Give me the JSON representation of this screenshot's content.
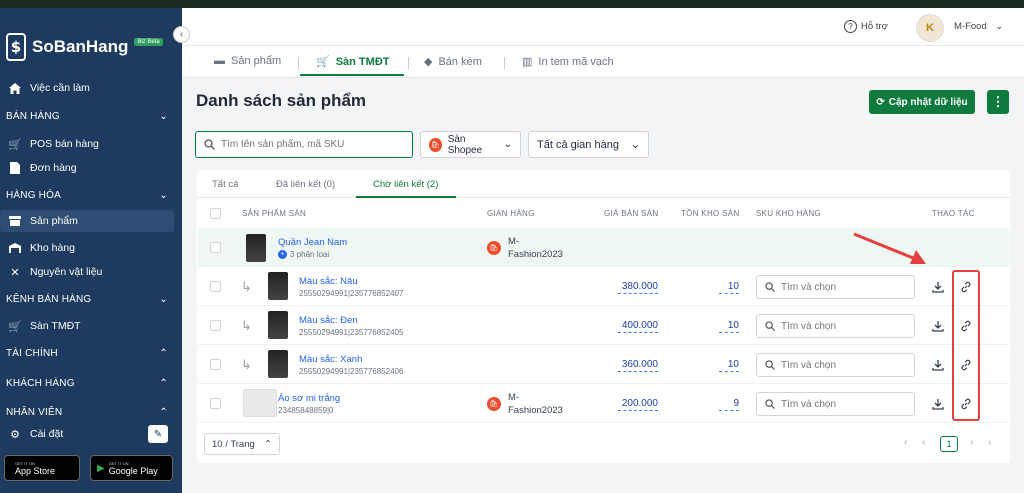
{
  "brand": {
    "name": "SoBanHang",
    "badge": "Biz Beta",
    "logo_glyph": "$"
  },
  "sidebar": {
    "todo": "Việc cần làm",
    "sales_section": "BÁN HÀNG",
    "pos": "POS bán hàng",
    "orders": "Đơn hàng",
    "goods_section": "HÀNG HÓA",
    "products": "Sản phẩm",
    "warehouse": "Kho hàng",
    "materials": "Nguyên vật liệu",
    "channels_section": "KÊNH BÁN HÀNG",
    "ecommerce": "Sàn TMĐT",
    "finance_section": "TÀI CHÍNH",
    "customers_section": "KHÁCH HÀNG",
    "staff_section": "NHÂN VIÊN",
    "settings": "Cài đặt",
    "app_store_small": "GET IT ON",
    "app_store": "App Store",
    "google_play_small": "GET IT ON",
    "google_play": "Google Play"
  },
  "header": {
    "help": "Hỗ trợ",
    "user": "M-Food",
    "avatar_initials": "K"
  },
  "top_tabs": [
    "Sản phẩm",
    "Sàn TMĐT",
    "Bán kèm",
    "In tem mã vạch"
  ],
  "page": {
    "title": "Danh sách sản phẩm",
    "update_button": "Cập nhật dữ liệu",
    "more_button": "⋮",
    "search_placeholder": "Tìm tên sản phẩm, mã SKU",
    "platform_filter": "Sàn Shopee",
    "store_filter": "Tất cả gian hàng"
  },
  "sub_tabs": [
    "Tất cả",
    "Đã liên kết (0)",
    "Chờ liên kết (2)"
  ],
  "table": {
    "headers": [
      "SẢN PHẨM SÀN",
      "GIAN HÀNG",
      "GIÁ BÁN SÀN",
      "TỒN KHO SÀN",
      "SKU KHO HÀNG",
      "THAO TÁC"
    ],
    "sku_placeholder": "Tìm và chọn",
    "rows": [
      {
        "name": "Quần Jean Nam",
        "variants": "3 phân loại",
        "store_line1": "M-",
        "store_line2": "Fashion2023"
      },
      {
        "name": "Màu sắc: Nâu",
        "code": "25550294991|235776852407",
        "price": "380.000",
        "stock": "10"
      },
      {
        "name": "Màu sắc: Đen",
        "code": "25550294991|235776852405",
        "price": "400.000",
        "stock": "10"
      },
      {
        "name": "Màu sắc: Xanh",
        "code": "25550294991|235776852406",
        "price": "360.000",
        "stock": "10"
      },
      {
        "name": "Áo sơ mi trắng",
        "code": "23485848859|0",
        "store_line1": "M-",
        "store_line2": "Fashion2023",
        "price": "200.000",
        "stock": "9"
      }
    ]
  },
  "pager": {
    "size": "10 / Trang",
    "current": "1"
  },
  "colors": {
    "sidebar": "#1e3a5f",
    "accent": "#0f7a3d",
    "highlight": "#e53e3e"
  }
}
